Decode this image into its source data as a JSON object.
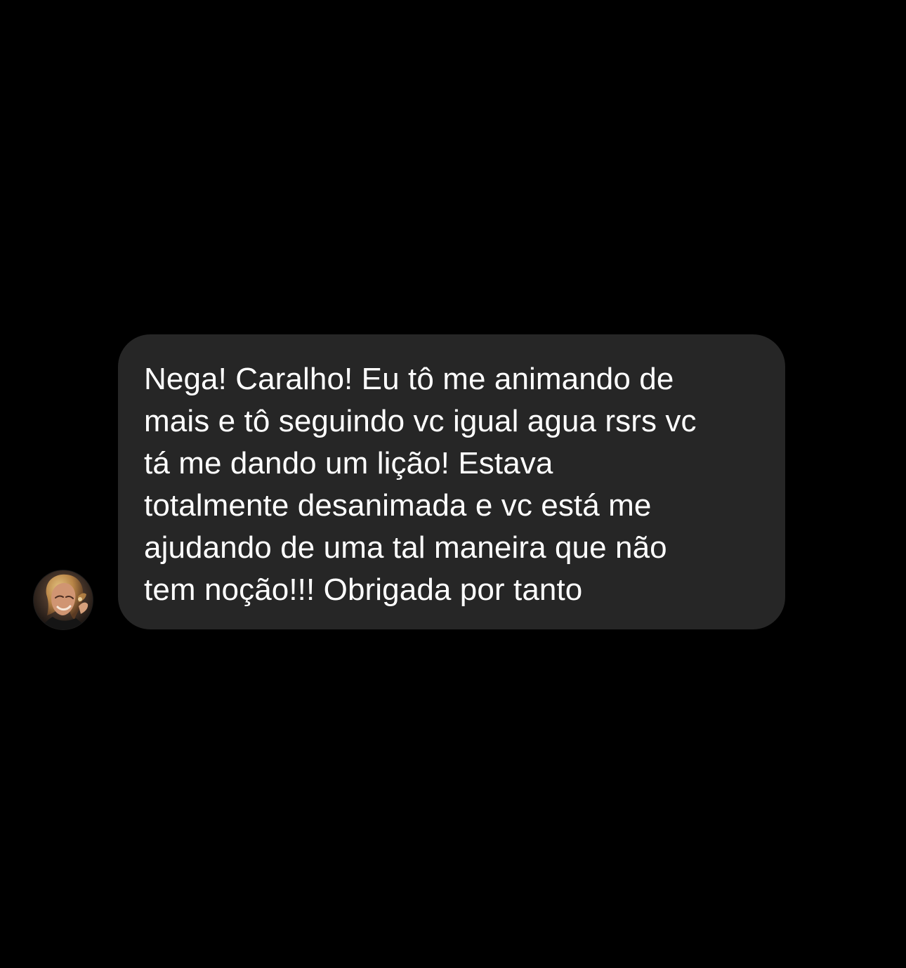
{
  "conversation": {
    "avatar_icon": "profile-photo-avatar",
    "message": {
      "lines": [
        "Nega! Caralho! Eu tô me animando de",
        "mais e tô seguindo vc igual agua rsrs vc",
        "tá me dando um lição! Estava",
        "totalmente desanimada e vc está me",
        "ajudando de uma tal maneira que não",
        "tem noção!!! Obrigada por tanto"
      ]
    },
    "colors": {
      "background": "#000000",
      "bubble": "#262626",
      "text": "#ffffff"
    }
  }
}
